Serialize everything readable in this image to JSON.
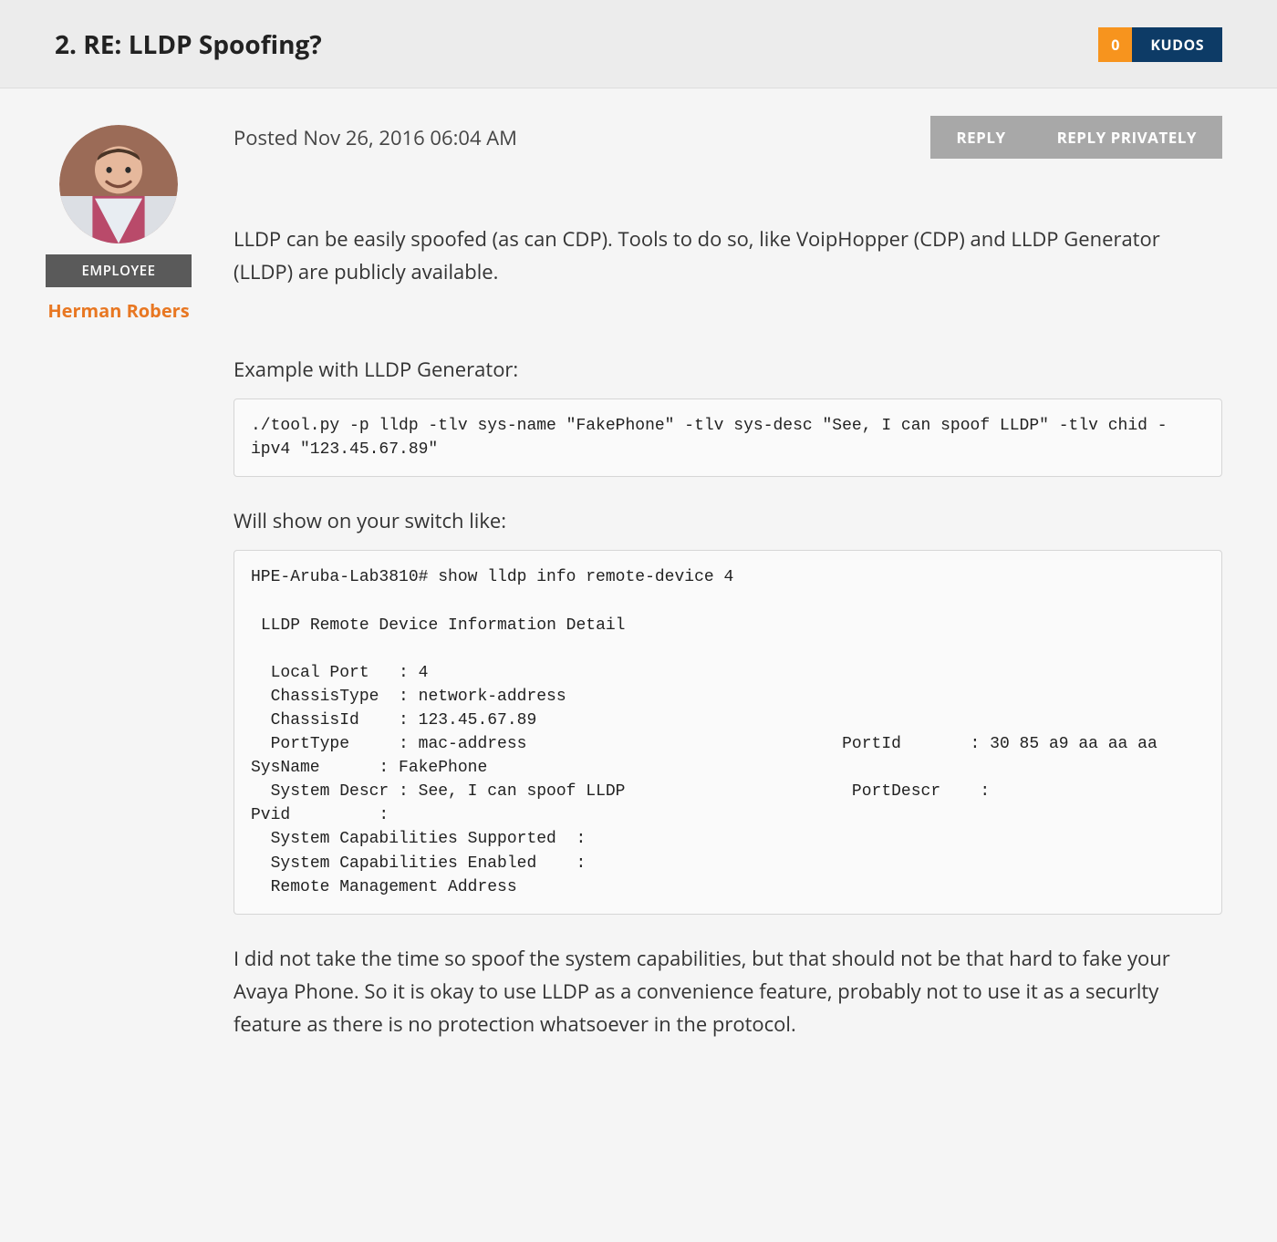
{
  "header": {
    "title": "2.  RE: LLDP Spoofing?",
    "kudos_count": "0",
    "kudos_label": "KUDOS"
  },
  "author": {
    "badge": "EMPLOYEE",
    "name": "Herman Robers"
  },
  "meta": {
    "posted": "Posted Nov 26, 2016 06:04 AM",
    "reply_label": "REPLY",
    "reply_private_label": "REPLY PRIVATELY"
  },
  "body": {
    "p1": "LLDP can be easily spoofed (as can CDP). Tools to do so, like VoipHopper (CDP) and LLDP Generator (LLDP) are publicly available.",
    "p2": "Example with LLDP Generator:",
    "code1": "./tool.py -p lldp -tlv sys-name \"FakePhone\" -tlv sys-desc \"See, I can spoof LLDP\" -tlv chid -ipv4 \"123.45.67.89\"",
    "p3": "Will show on your switch like:",
    "code2": "HPE-Aruba-Lab3810# show lldp info remote-device 4\n\n LLDP Remote Device Information Detail\n\n  Local Port   : 4\n  ChassisType  : network-address\n  ChassisId    : 123.45.67.89\n  PortType     : mac-address                                PortId       : 30 85 a9 aa aa aa                         SysName      : FakePhone\n  System Descr : See, I can spoof LLDP                       PortDescr    :                                           Pvid         :\n  System Capabilities Supported  :\n  System Capabilities Enabled    :\n  Remote Management Address",
    "p4": "I did not take the time so spoof the system capabilities, but that should not be that hard to fake your Avaya Phone. So it is okay to use LLDP as a convenience feature, probably not to use it as a securlty feature as there is no protection whatsoever in the protocol."
  }
}
